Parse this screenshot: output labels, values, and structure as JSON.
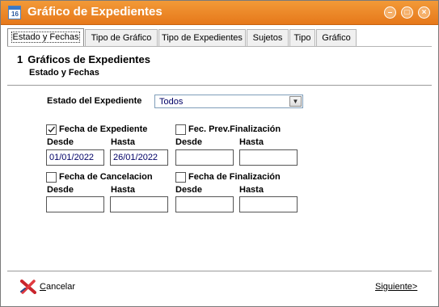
{
  "window": {
    "title": "Gráfico de Expedientes",
    "app_icon_text": "16"
  },
  "tabs": [
    {
      "label": "Estado y Fechas",
      "active": true
    },
    {
      "label": "Tipo de Gráfico",
      "active": false
    },
    {
      "label": "Tipo de Expedientes",
      "active": false
    },
    {
      "label": "Sujetos",
      "active": false
    },
    {
      "label": "Tipo",
      "active": false
    },
    {
      "label": "Gráfico",
      "active": false
    }
  ],
  "section": {
    "number": "1",
    "title": "Gráficos de Expedientes",
    "subtitle": "Estado y Fechas"
  },
  "estado": {
    "label": "Estado del Expediente",
    "selected": "Todos"
  },
  "groups": {
    "fecha_expediente": {
      "label": "Fecha de Expediente",
      "checked": true,
      "desde": "01/01/2022",
      "hasta": "26/01/2022"
    },
    "fec_prev_finalizacion": {
      "label": "Fec. Prev.Finalización",
      "checked": false,
      "desde": "",
      "hasta": ""
    },
    "fecha_cancelacion": {
      "label": "Fecha de Cancelacion",
      "checked": false,
      "desde": "",
      "hasta": ""
    },
    "fecha_finalizacion": {
      "label": "Fecha de Finalización",
      "checked": false,
      "desde": "",
      "hasta": ""
    }
  },
  "range_labels": {
    "desde": "Desde",
    "hasta": "Hasta"
  },
  "footer": {
    "cancel_first": "C",
    "cancel_rest": "ancelar",
    "next_first": "S",
    "next_rest": "iguiente>"
  },
  "colors": {
    "titlebar": "#e6781a",
    "input_text": "#000066"
  }
}
